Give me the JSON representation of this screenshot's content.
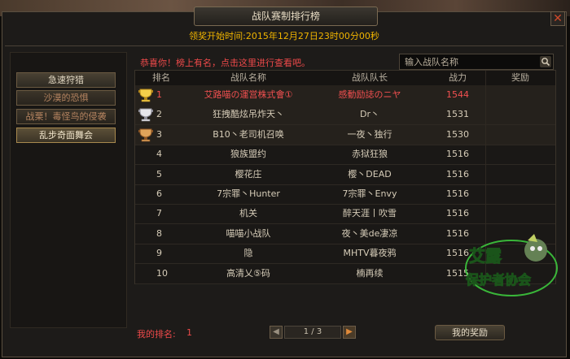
{
  "window": {
    "title": "战队赛制排行榜",
    "close_label": "✕"
  },
  "timeline": "领奖开始时间:2015年12月27日23时00分00秒",
  "sidebar": {
    "items": [
      {
        "label": "急速狩猎",
        "state": "normal"
      },
      {
        "label": "沙漠的恐惧",
        "state": "dim"
      },
      {
        "label": "战栗！毒怪鸟的侵袭",
        "state": "dim"
      },
      {
        "label": "乱步奇面舞会",
        "state": "selected"
      }
    ]
  },
  "congrats": "恭喜你！榜上有名，点击这里进行查看吧。",
  "search": {
    "placeholder": "输入战队名称",
    "value": ""
  },
  "table": {
    "headers": [
      "排名",
      "战队名称",
      "战队队长",
      "战力",
      "奖励"
    ],
    "rows": [
      {
        "rank": "1",
        "team": "艾路喵の運営株式會①",
        "captain": "感動励誌のニヤ",
        "power": "1544",
        "trophy": "gold"
      },
      {
        "rank": "2",
        "team": "狂拽酷炫吊炸天丶",
        "captain": "Dr丶",
        "power": "1531",
        "trophy": "silver"
      },
      {
        "rank": "3",
        "team": "B10丶老司机召唤",
        "captain": "一夜丶独行",
        "power": "1530",
        "trophy": "bronze"
      },
      {
        "rank": "4",
        "team": "狼族盟约",
        "captain": "赤狱狂狼",
        "power": "1516",
        "trophy": ""
      },
      {
        "rank": "5",
        "team": "樱花庄",
        "captain": "樱丶DEAD",
        "power": "1516",
        "trophy": ""
      },
      {
        "rank": "6",
        "team": "7宗罪丶Hunter",
        "captain": "7宗罪丶Envy",
        "power": "1516",
        "trophy": ""
      },
      {
        "rank": "7",
        "team": "机关",
        "captain": "醉天涯丨吹雪",
        "power": "1516",
        "trophy": ""
      },
      {
        "rank": "8",
        "team": "喵喵小战队",
        "captain": "夜丶美de凄凉",
        "power": "1516",
        "trophy": ""
      },
      {
        "rank": "9",
        "team": "隐",
        "captain": "MHTV暮夜鸦",
        "power": "1516",
        "trophy": ""
      },
      {
        "rank": "10",
        "team": "高清乂⑤码",
        "captain": "楠再续",
        "power": "1515",
        "trophy": ""
      }
    ]
  },
  "my_rank": {
    "label": "我的排名:",
    "value": "1"
  },
  "pager": {
    "text": "1 / 3",
    "prev": "◀",
    "next": "▶"
  },
  "reward_button": "我的奖励",
  "watermark": {
    "line1": "艾露",
    "line2": "保护者协会"
  },
  "colors": {
    "accent_red": "#ee4a4a",
    "gold": "#f0b400"
  }
}
